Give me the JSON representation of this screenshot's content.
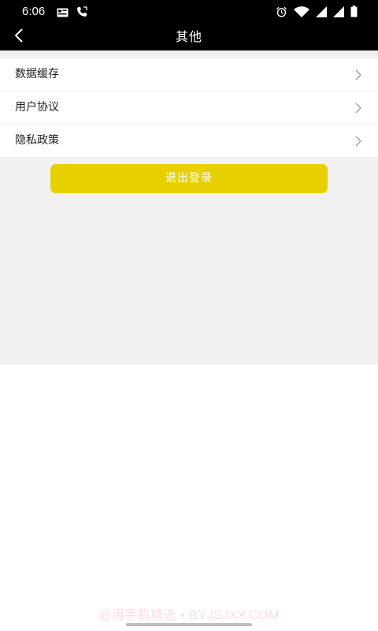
{
  "status_bar": {
    "time": "6:06",
    "icons": [
      "notification-card-icon",
      "call-icon",
      "alarm-icon",
      "wifi-icon",
      "signal-icon",
      "signal-icon",
      "battery-icon"
    ]
  },
  "nav": {
    "title": "其他",
    "back_icon": "chevron-left-icon"
  },
  "menu": {
    "items": [
      {
        "label": "数据缓存",
        "icon": "chevron-right-icon"
      },
      {
        "label": "用户协议",
        "icon": "chevron-right-icon"
      },
      {
        "label": "隐私政策",
        "icon": "chevron-right-icon"
      }
    ]
  },
  "logout": {
    "label": "退出登录"
  },
  "watermark": {
    "text": "必用手机精选 • BYJSJXY.COM"
  },
  "colors": {
    "header_bg": "#000000",
    "accent": "#e8d000",
    "page_bg": "#f1f1f1",
    "text": "#222222"
  }
}
